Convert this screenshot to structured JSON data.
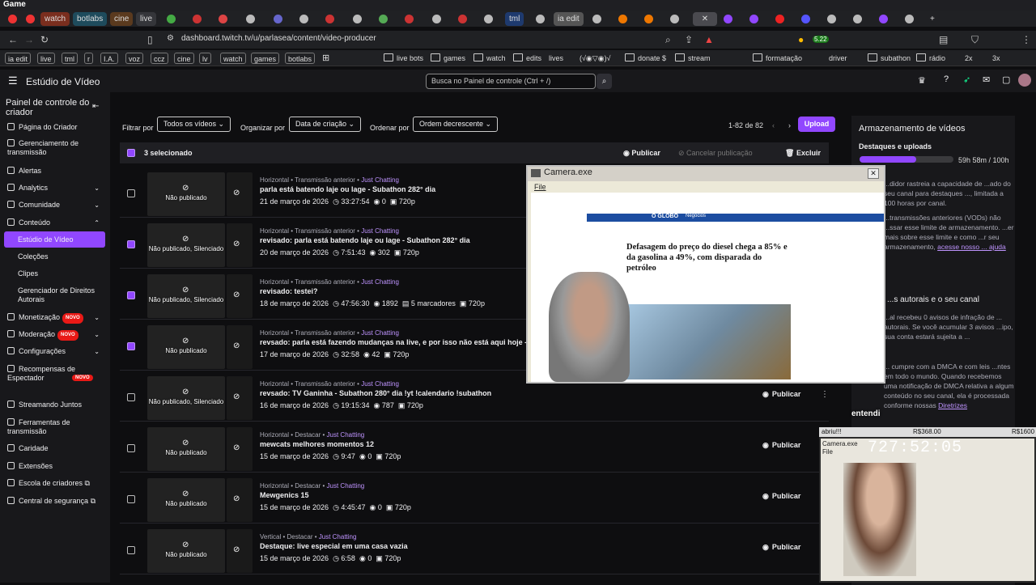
{
  "window": {
    "title": "Game"
  },
  "tabs": [
    "watch",
    "botlabs",
    "cine",
    "live",
    "tml",
    "ia edit"
  ],
  "address": {
    "url": "dashboard.twitch.tv/u/parlasea/content/video-producer"
  },
  "extension_badge": "5.22",
  "bookmarks": [
    "ia edit",
    "live",
    "tml",
    "r",
    "I.A.",
    "voz",
    "ccz",
    "cine",
    "lv",
    "watch",
    "games",
    "botlabs",
    "live bots",
    "games",
    "watch",
    "edits",
    "lives",
    "(√◉▽◉)√",
    "donate $",
    "stream",
    "formatação",
    "driver",
    "subathon",
    "rádio",
    "2x",
    "3x"
  ],
  "header": {
    "title": "Estúdio de Vídeo",
    "search_placeholder": "Busca no Painel de controle (Ctrl + /)"
  },
  "sidebar": {
    "title": "Painel de controle do criador",
    "items": [
      "Página do Criador",
      "Gerenciamento de transmissão",
      "Alertas",
      "Analytics",
      "Comunidade",
      "Conteúdo",
      "Estúdio de Vídeo",
      "Coleções",
      "Clipes",
      "Gerenciador de Direitos Autorais",
      "Monetização",
      "Moderação",
      "Configurações",
      "Recompensas de Espectador",
      "Streamando Juntos",
      "Ferramentas de transmissão",
      "Caridade",
      "Extensões",
      "Escola de criadores",
      "Central de segurança"
    ],
    "novo": "NOVO"
  },
  "filters": {
    "filter_label": "Filtrar por",
    "filter_value": "Todos os vídeos",
    "organize_label": "Organizar por",
    "organize_value": "Data de criação",
    "order_label": "Ordenar por",
    "order_value": "Ordem decrescente",
    "pagination": "1-82 de 82",
    "upload": "Upload"
  },
  "selection": {
    "count": "3 selecionado",
    "publish": "Publicar",
    "unpublish": "Cancelar publicação",
    "delete": "Excluir"
  },
  "videos": [
    {
      "meta": "Horizontal • Transmissão anterior •",
      "cat": "Just Chatting",
      "title": "parla está batendo laje ou lage - Subathon 282° dia",
      "date": "21 de março de 2026",
      "duration": "33:27:54",
      "views": "0",
      "quality": "720p",
      "status": "Não publicado",
      "checked": false
    },
    {
      "meta": "Horizontal • Transmissão anterior •",
      "cat": "Just Chatting",
      "title": "revisado: parla está batendo laje ou lage - Subathon 282° dia",
      "date": "20 de março de 2026",
      "duration": "7:51:43",
      "views": "302",
      "quality": "720p",
      "status": "Não publicado, Silenciado",
      "checked": true
    },
    {
      "meta": "Horizontal • Transmissão anterior •",
      "cat": "Just Chatting",
      "title": "revisado: testei?",
      "date": "18 de março de 2026",
      "duration": "47:56:30",
      "views": "1892",
      "extra": "5 marcadores",
      "quality": "720p",
      "status": "Não publicado, Silenciado",
      "checked": true
    },
    {
      "meta": "Horizontal • Transmissão anterior •",
      "cat": "Just Chatting",
      "title": "revsado: parla está fazendo mudanças na live, e por isso não está aqui hoje - Sub",
      "date": "17 de março de 2026",
      "duration": "32:58",
      "views": "42",
      "quality": "720p",
      "status": "Não publicado",
      "checked": true
    },
    {
      "meta": "Horizontal • Transmissão anterior •",
      "cat": "Just Chatting",
      "title": "revsado: TV Ganinha - Subathon 280° dia !yt !calendario !subathon",
      "date": "16 de março de 2026",
      "duration": "19:15:34",
      "views": "787",
      "quality": "720p",
      "status": "Não publicado, Silenciado",
      "checked": false,
      "pub": "Publicar"
    },
    {
      "meta": "Horizontal • Destacar •",
      "cat": "Just Chatting",
      "title": "mewcats melhores momentos 12",
      "date": "15 de março de 2026",
      "duration": "9:47",
      "views": "0",
      "quality": "720p",
      "status": "Não publicado",
      "checked": false,
      "pub": "Publicar"
    },
    {
      "meta": "Horizontal • Destacar •",
      "cat": "Just Chatting",
      "title": "Mewgenics 15",
      "date": "15 de março de 2026",
      "duration": "4:45:47",
      "views": "0",
      "quality": "720p",
      "status": "Não publicado",
      "checked": false,
      "pub": "Publicar"
    },
    {
      "meta": "Vertical • Destacar •",
      "cat": "Just Chatting",
      "title": "Destaque: live especial em uma casa vazia",
      "date": "15 de março de 2026",
      "duration": "6:58",
      "views": "0",
      "quality": "720p",
      "status": "Não publicado",
      "checked": false,
      "pub": "Publicar"
    }
  ],
  "right_panel": {
    "title": "Armazenamento de vídeos",
    "sub": "Destaques e uploads",
    "usage": "59h 58m / 100h",
    "usage_fraction": 0.6,
    "p1": "...didor rastreia a capacidade de ...ado do seu canal para destaques ..., limitada a 100 horas por canal.",
    "p2": "...transmissões anteriores (VODs) não ...ssar esse limite de armazenamento. ...er mais sobre esse limite e como ...r seu armazenamento,",
    "p2_link": "acesse nosso ... ajuda",
    "h2": "...s autorais e o seu canal",
    "p3": "...al recebeu 0 avisos de infração de ... autorais. Se você acumular 3 avisos ...ipo, sua conta estará sujeita a ...",
    "p4": "... cumpre com a DMCA e com leis ...ntes em todo o mundo. Quando recebemos uma notificação de DMCA relativa a algum conteúdo no seu canal, ela é processada conforme nossas",
    "p4_link": "Diretrizes"
  },
  "camera": {
    "title": "Camera.exe",
    "menu": "File",
    "headline": "Defasagem do preço do diesel chega a 85% e da gasolina a 49%, com disparada do petróleo",
    "site": "O GLOBO",
    "section": "Negócios"
  },
  "overlay": {
    "chat": "entendi",
    "sub_title": "Camera.exe",
    "sub_menu": "File",
    "bar_left": "abriu!!!",
    "bar_mid": "R$368.00",
    "bar_right": "R$1600",
    "timer": "727:52:05"
  }
}
